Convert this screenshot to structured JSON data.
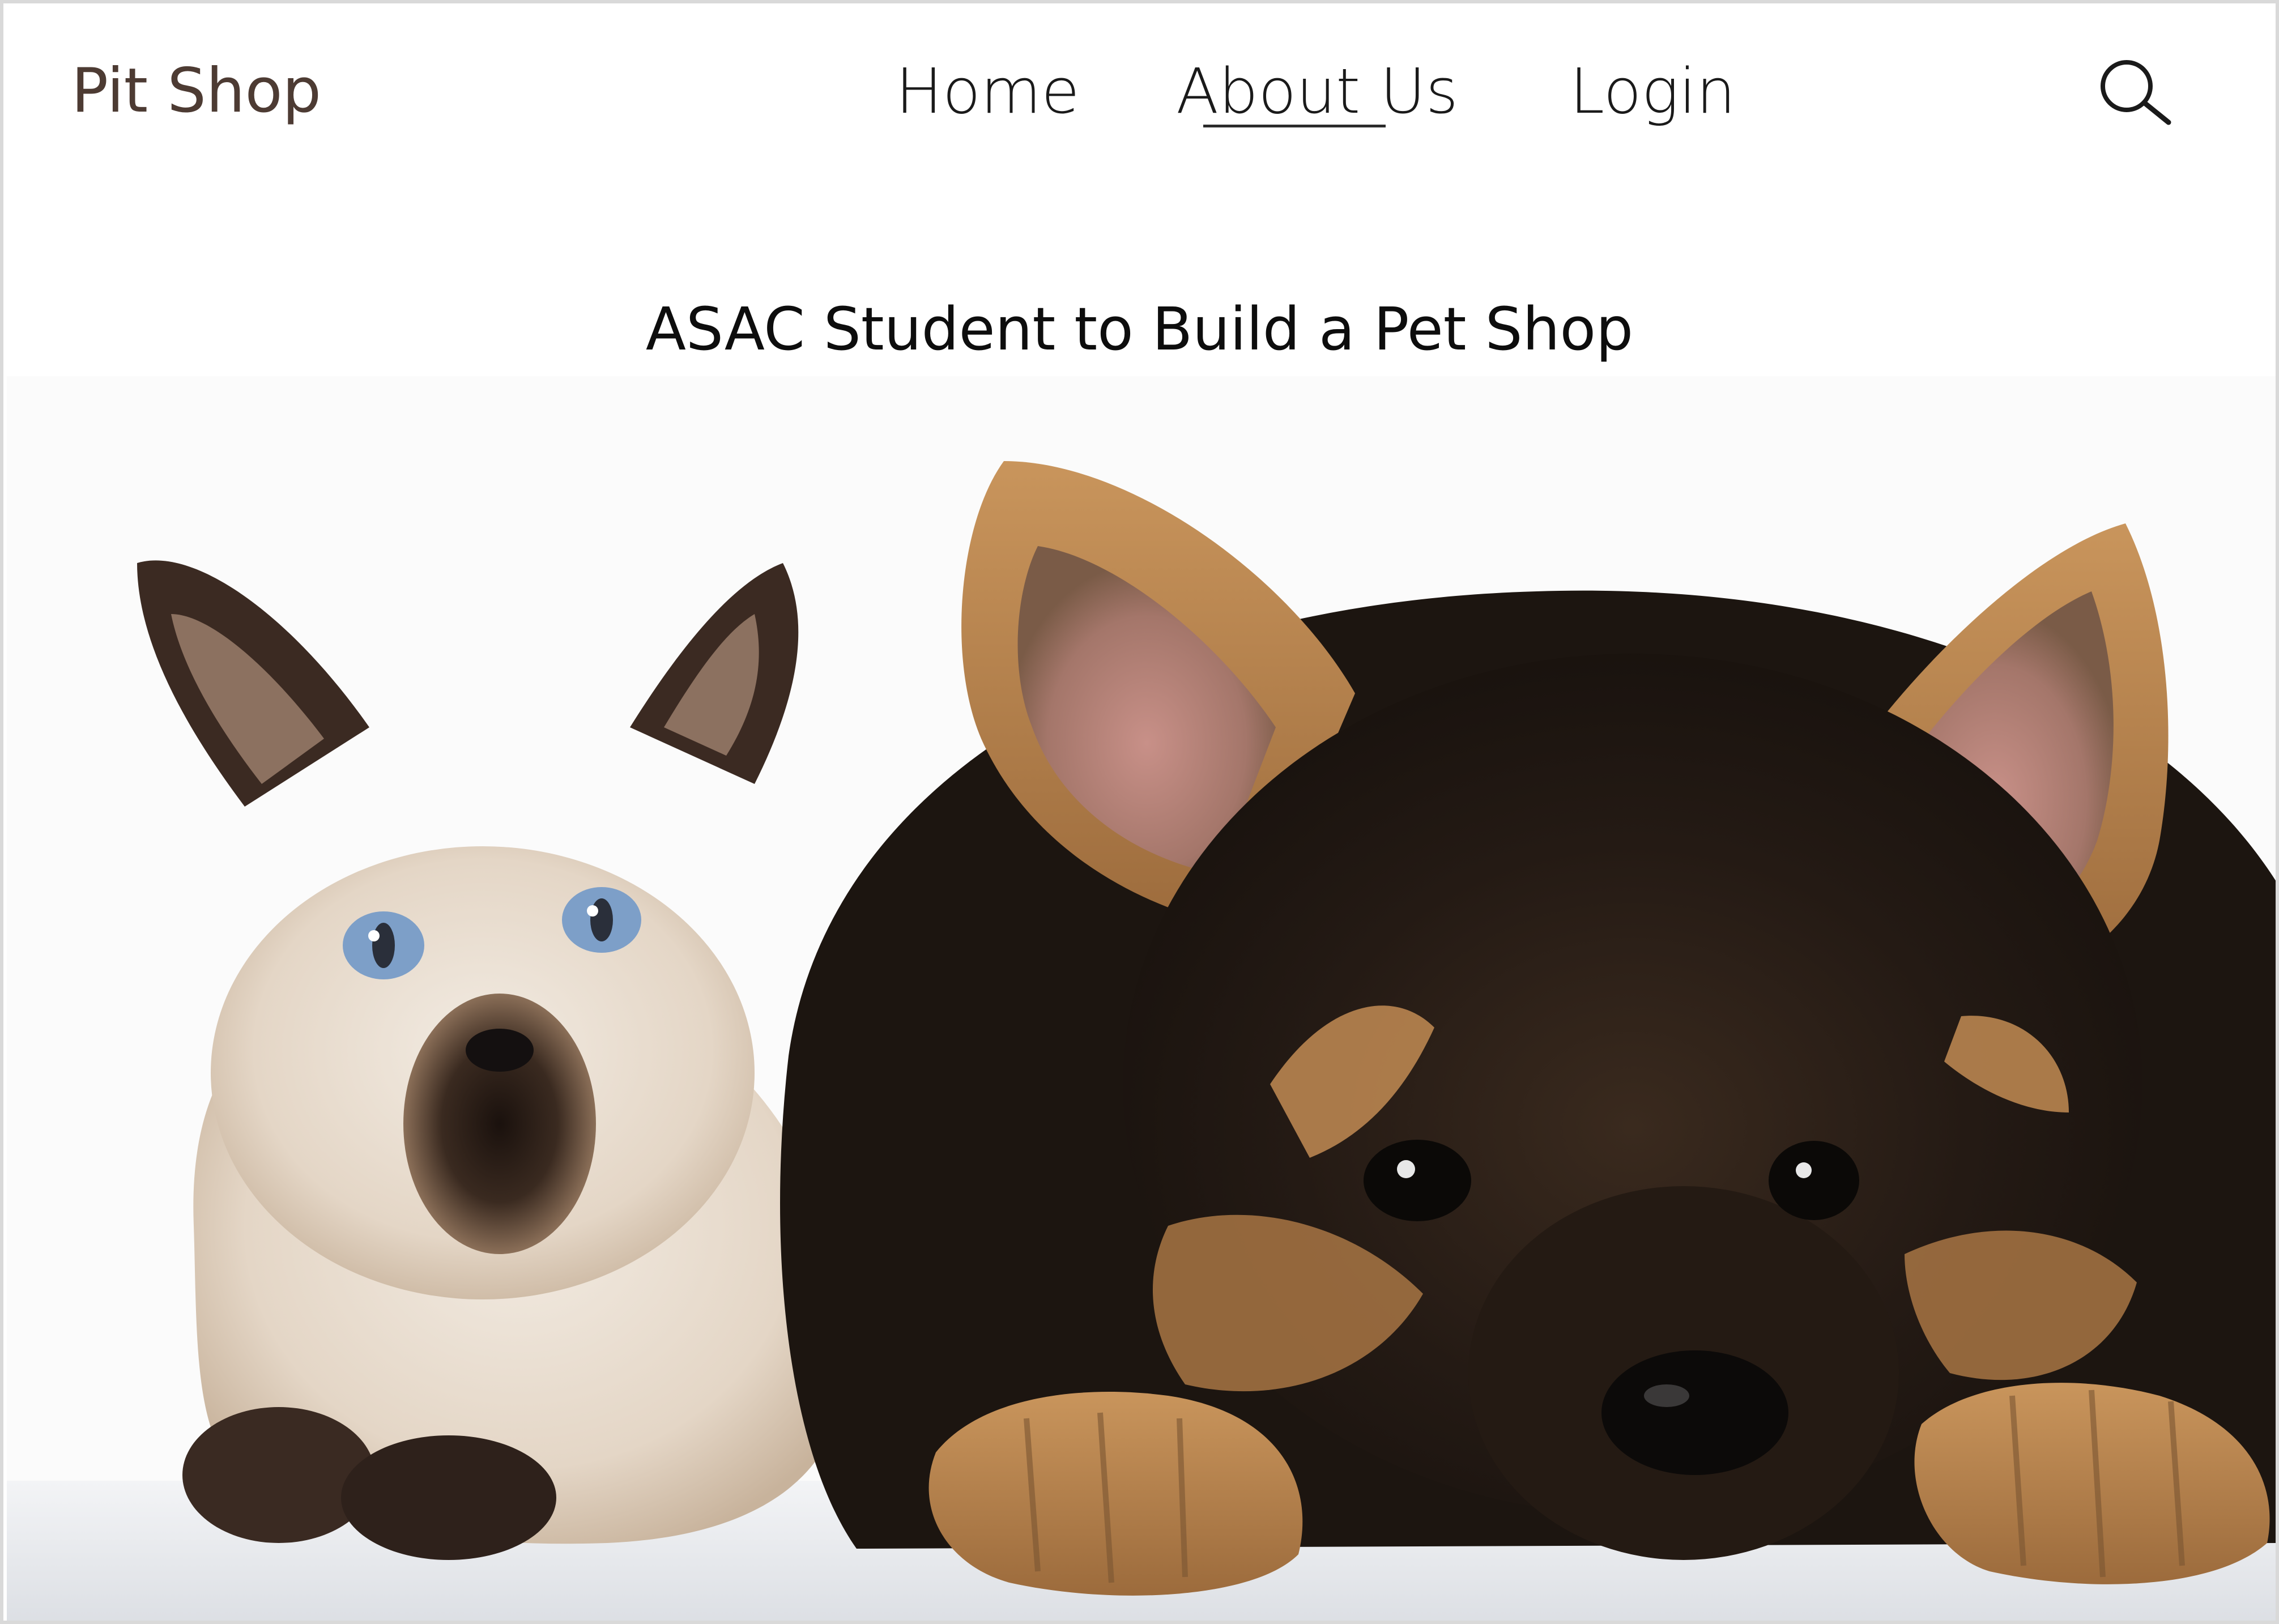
{
  "header": {
    "logo": "Pit Shop",
    "nav": {
      "home": "Home",
      "about": "About Us",
      "login": "Login"
    },
    "active_nav": "About Us",
    "search_icon": "search-icon"
  },
  "main": {
    "headline": "ASAC Student to Build a Pet Shop",
    "hero_image": {
      "subject": "Siamese kitten and German Shepherd puppy"
    }
  },
  "colors": {
    "logo": "#4d3b33",
    "nav_text": "#1a1a1a",
    "headline": "#0d0d0d",
    "background": "#ffffff"
  }
}
